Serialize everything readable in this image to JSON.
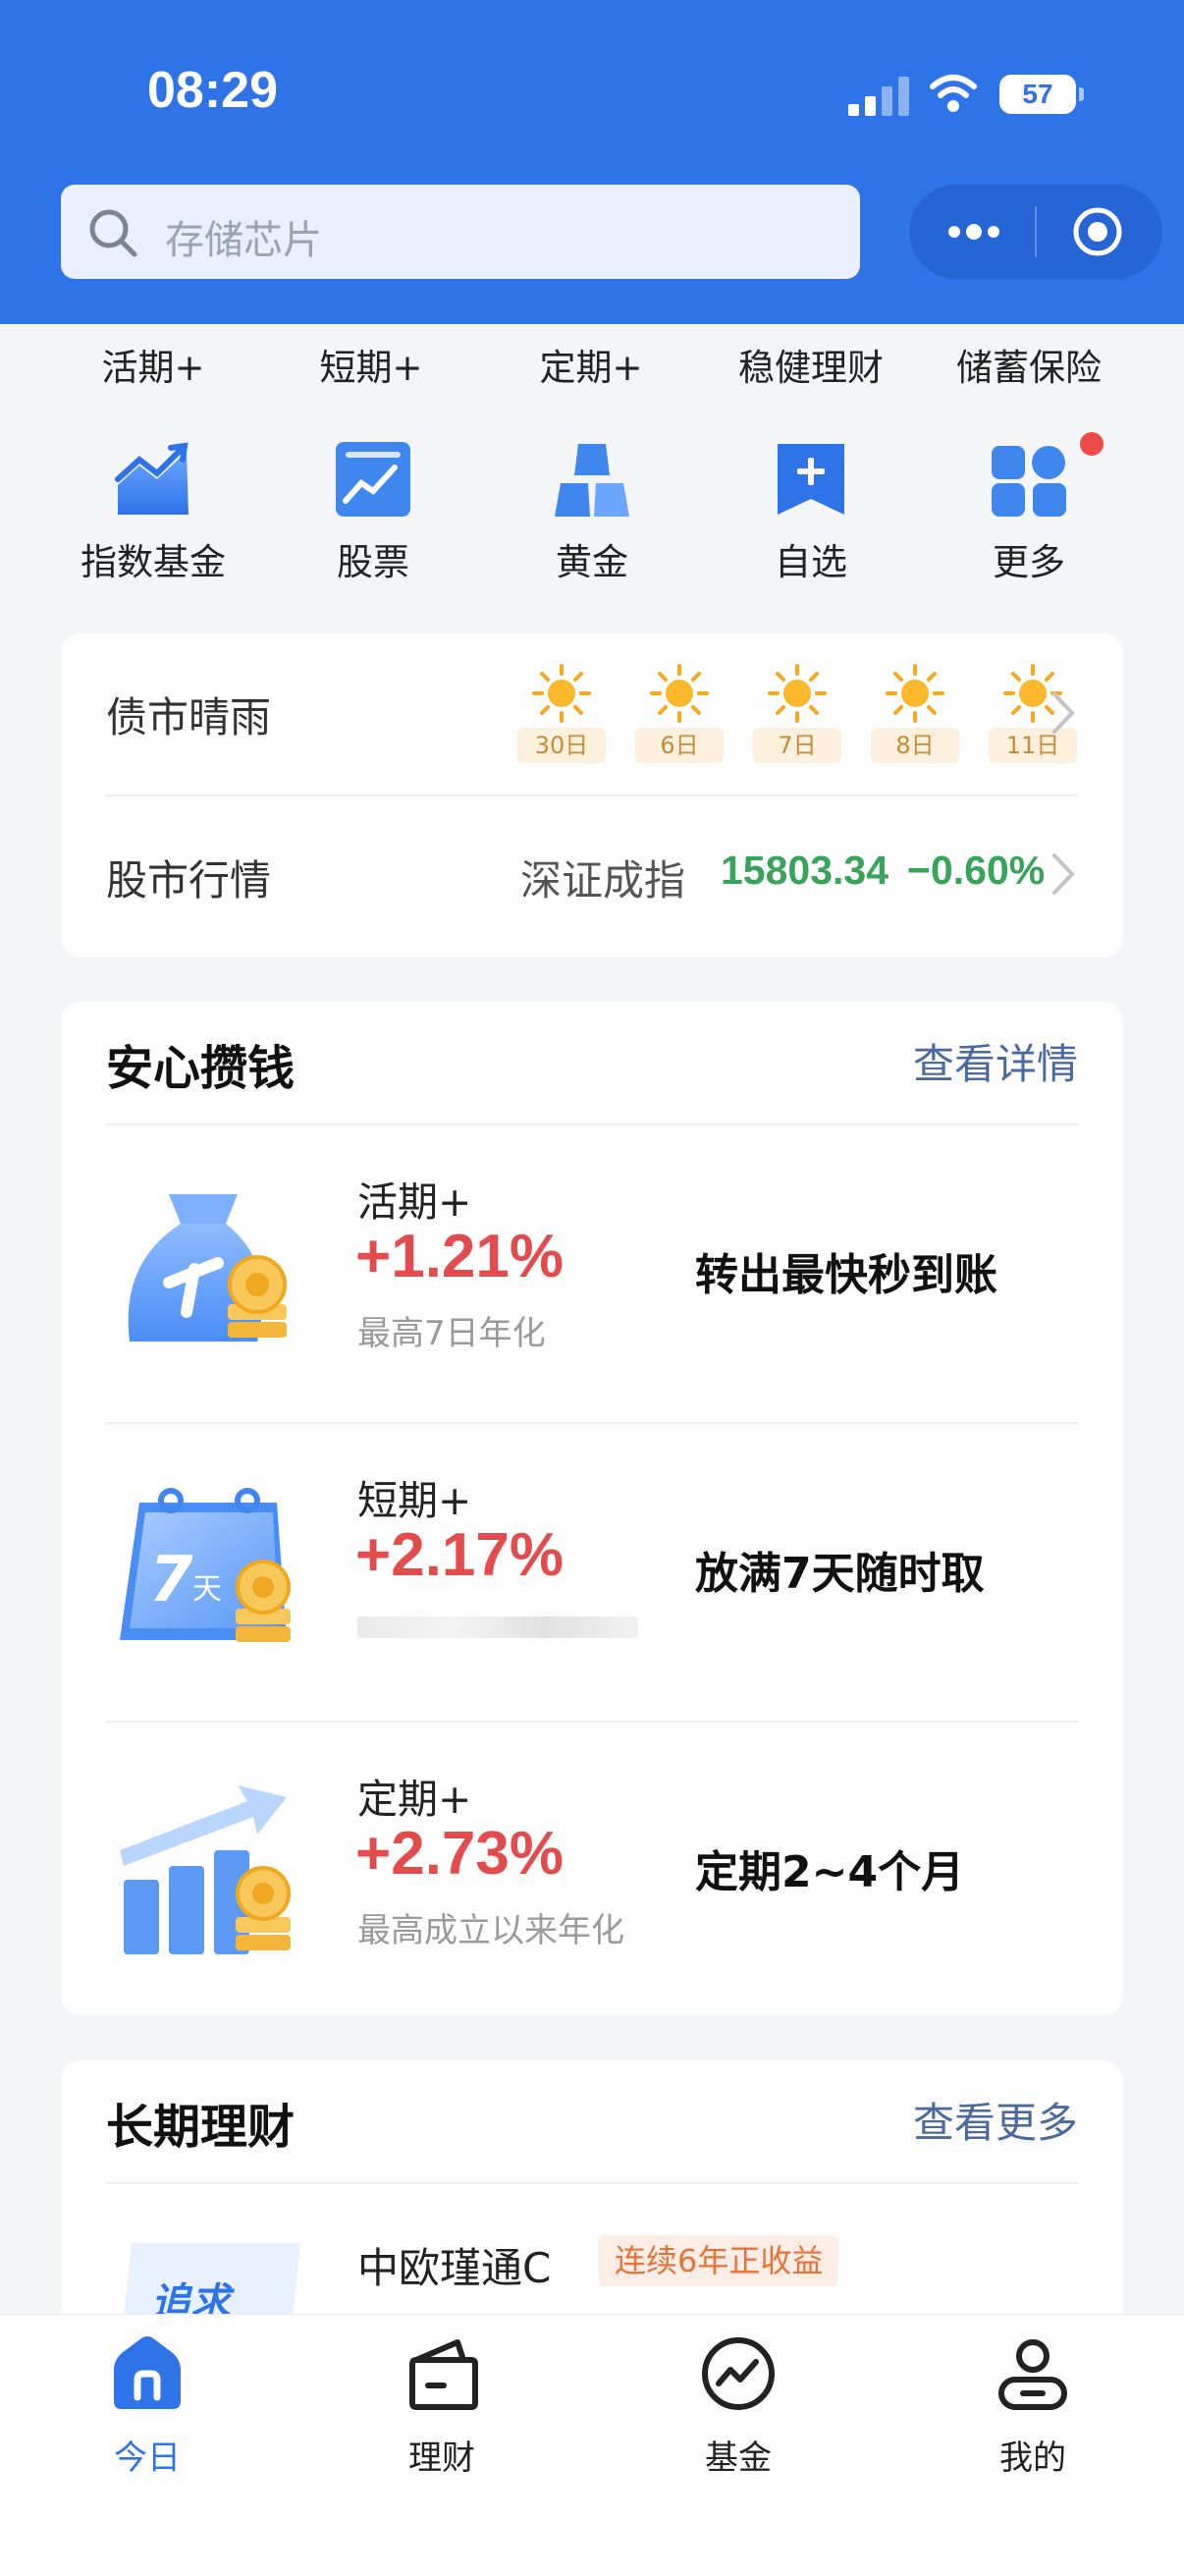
{
  "status_bar": {
    "time": "08:29",
    "battery": "57"
  },
  "search": {
    "placeholder": "存储芯片"
  },
  "category_tabs": [
    "活期+",
    "短期+",
    "定期+",
    "稳健理财",
    "储蓄保险"
  ],
  "quick_entries": [
    {
      "label": "指数基金",
      "icon": "index-fund-icon"
    },
    {
      "label": "股票",
      "icon": "stock-icon"
    },
    {
      "label": "黄金",
      "icon": "gold-icon"
    },
    {
      "label": "自选",
      "icon": "watchlist-icon"
    },
    {
      "label": "更多",
      "icon": "more-grid-icon",
      "badge_dot": true
    }
  ],
  "market": {
    "bond_title": "债市晴雨",
    "bond_forecast": [
      {
        "icon": "sun-icon",
        "label": "30日"
      },
      {
        "icon": "sun-icon",
        "label": "6日"
      },
      {
        "icon": "sun-icon",
        "label": "7日"
      },
      {
        "icon": "sun-icon",
        "label": "8日"
      },
      {
        "icon": "sun-icon",
        "label": "11日"
      }
    ],
    "stock_title": "股市行情",
    "index_name": "深证成指",
    "index_value": "15803.34",
    "index_change": "−0.60%"
  },
  "savings": {
    "title": "安心攒钱",
    "link": "查看详情",
    "products": [
      {
        "name": "活期+",
        "rate": "+1.21%",
        "sub": "最高7日年化",
        "tagline": "转出最快秒到账"
      },
      {
        "name": "短期+",
        "rate": "+2.17%",
        "sub": "",
        "tagline": "放满7天随时取"
      },
      {
        "name": "定期+",
        "rate": "+2.73%",
        "sub": "最高成立以来年化",
        "tagline": "定期2~4个月"
      }
    ]
  },
  "long_term": {
    "title": "长期理财",
    "link": "查看更多",
    "product_name": "中欧瑾通C",
    "product_badge": "连续6年正收益",
    "pic_text": "追求"
  },
  "tab_bar": [
    {
      "label": "今日",
      "icon": "home-icon",
      "active": true
    },
    {
      "label": "理财",
      "icon": "wallet-icon"
    },
    {
      "label": "基金",
      "icon": "fund-chart-icon"
    },
    {
      "label": "我的",
      "icon": "profile-icon"
    }
  ],
  "colors": {
    "brand": "#2f73e8",
    "rate_red": "#e34c4c",
    "market_green": "#3aa35a",
    "link": "#4a6aa0"
  }
}
